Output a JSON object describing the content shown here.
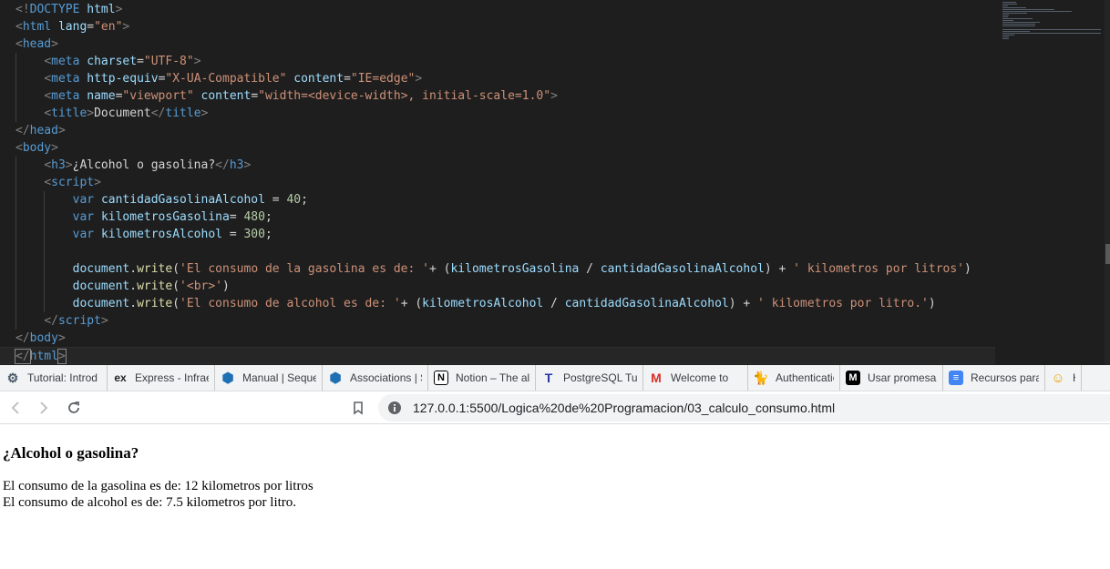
{
  "editor": {
    "lines": [
      [
        [
          "t-pun",
          "<!"
        ],
        [
          "t-doc",
          "DOCTYPE"
        ],
        [
          "t-text",
          " "
        ],
        [
          "t-attr",
          "html"
        ],
        [
          "t-pun",
          ">"
        ]
      ],
      [
        [
          "t-pun",
          "<"
        ],
        [
          "t-tag",
          "html"
        ],
        [
          "t-text",
          " "
        ],
        [
          "t-attr",
          "lang"
        ],
        [
          "t-text",
          "="
        ],
        [
          "t-str",
          "\"en\""
        ],
        [
          "t-pun",
          ">"
        ]
      ],
      [
        [
          "t-pun",
          "<"
        ],
        [
          "t-tag",
          "head"
        ],
        [
          "t-pun",
          ">"
        ]
      ],
      [
        [
          "t-text",
          "    "
        ],
        [
          "t-pun",
          "<"
        ],
        [
          "t-tag",
          "meta"
        ],
        [
          "t-text",
          " "
        ],
        [
          "t-attr",
          "charset"
        ],
        [
          "t-text",
          "="
        ],
        [
          "t-str",
          "\"UTF-8\""
        ],
        [
          "t-pun",
          ">"
        ]
      ],
      [
        [
          "t-text",
          "    "
        ],
        [
          "t-pun",
          "<"
        ],
        [
          "t-tag",
          "meta"
        ],
        [
          "t-text",
          " "
        ],
        [
          "t-attr",
          "http-equiv"
        ],
        [
          "t-text",
          "="
        ],
        [
          "t-str",
          "\"X-UA-Compatible\""
        ],
        [
          "t-text",
          " "
        ],
        [
          "t-attr",
          "content"
        ],
        [
          "t-text",
          "="
        ],
        [
          "t-str",
          "\"IE=edge\""
        ],
        [
          "t-pun",
          ">"
        ]
      ],
      [
        [
          "t-text",
          "    "
        ],
        [
          "t-pun",
          "<"
        ],
        [
          "t-tag",
          "meta"
        ],
        [
          "t-text",
          " "
        ],
        [
          "t-attr",
          "name"
        ],
        [
          "t-text",
          "="
        ],
        [
          "t-str",
          "\"viewport\""
        ],
        [
          "t-text",
          " "
        ],
        [
          "t-attr",
          "content"
        ],
        [
          "t-text",
          "="
        ],
        [
          "t-str",
          "\"width=<device-width>, initial-scale=1.0\""
        ],
        [
          "t-pun",
          ">"
        ]
      ],
      [
        [
          "t-text",
          "    "
        ],
        [
          "t-pun",
          "<"
        ],
        [
          "t-tag",
          "title"
        ],
        [
          "t-pun",
          ">"
        ],
        [
          "t-text",
          "Document"
        ],
        [
          "t-pun",
          "</"
        ],
        [
          "t-tag",
          "title"
        ],
        [
          "t-pun",
          ">"
        ]
      ],
      [
        [
          "t-pun",
          "</"
        ],
        [
          "t-tag",
          "head"
        ],
        [
          "t-pun",
          ">"
        ]
      ],
      [
        [
          "t-pun",
          "<"
        ],
        [
          "t-tag",
          "body"
        ],
        [
          "t-pun",
          ">"
        ]
      ],
      [
        [
          "t-text",
          "    "
        ],
        [
          "t-pun",
          "<"
        ],
        [
          "t-tag",
          "h3"
        ],
        [
          "t-pun",
          ">"
        ],
        [
          "t-text",
          "¿Alcohol o gasolina?"
        ],
        [
          "t-pun",
          "</"
        ],
        [
          "t-tag",
          "h3"
        ],
        [
          "t-pun",
          ">"
        ]
      ],
      [
        [
          "t-text",
          "    "
        ],
        [
          "t-pun",
          "<"
        ],
        [
          "t-tag",
          "script"
        ],
        [
          "t-pun",
          ">"
        ]
      ],
      [
        [
          "t-text",
          "        "
        ],
        [
          "t-kw",
          "var"
        ],
        [
          "t-text",
          " "
        ],
        [
          "t-var",
          "cantidadGasolinaAlcohol"
        ],
        [
          "t-text",
          " = "
        ],
        [
          "t-num",
          "40"
        ],
        [
          "t-text",
          ";"
        ]
      ],
      [
        [
          "t-text",
          "        "
        ],
        [
          "t-kw",
          "var"
        ],
        [
          "t-text",
          " "
        ],
        [
          "t-var",
          "kilometrosGasolina"
        ],
        [
          "t-text",
          "= "
        ],
        [
          "t-num",
          "480"
        ],
        [
          "t-text",
          ";"
        ]
      ],
      [
        [
          "t-text",
          "        "
        ],
        [
          "t-kw",
          "var"
        ],
        [
          "t-text",
          " "
        ],
        [
          "t-var",
          "kilometrosAlcohol"
        ],
        [
          "t-text",
          " = "
        ],
        [
          "t-num",
          "300"
        ],
        [
          "t-text",
          ";"
        ]
      ],
      [
        [
          "t-text",
          ""
        ]
      ],
      [
        [
          "t-text",
          "        "
        ],
        [
          "t-var",
          "document"
        ],
        [
          "t-text",
          "."
        ],
        [
          "t-fn",
          "write"
        ],
        [
          "t-text",
          "("
        ],
        [
          "t-str",
          "'El consumo de la gasolina es de: '"
        ],
        [
          "t-text",
          "+ ("
        ],
        [
          "t-var",
          "kilometrosGasolina"
        ],
        [
          "t-text",
          " / "
        ],
        [
          "t-var",
          "cantidadGasolinaAlcohol"
        ],
        [
          "t-text",
          ") + "
        ],
        [
          "t-str",
          "' kilometros por litros'"
        ],
        [
          "t-text",
          ")"
        ]
      ],
      [
        [
          "t-text",
          "        "
        ],
        [
          "t-var",
          "document"
        ],
        [
          "t-text",
          "."
        ],
        [
          "t-fn",
          "write"
        ],
        [
          "t-text",
          "("
        ],
        [
          "t-str",
          "'<br>'"
        ],
        [
          "t-text",
          ")"
        ]
      ],
      [
        [
          "t-text",
          "        "
        ],
        [
          "t-var",
          "document"
        ],
        [
          "t-text",
          "."
        ],
        [
          "t-fn",
          "write"
        ],
        [
          "t-text",
          "("
        ],
        [
          "t-str",
          "'El consumo de alcohol es de: '"
        ],
        [
          "t-text",
          "+ ("
        ],
        [
          "t-var",
          "kilometrosAlcohol"
        ],
        [
          "t-text",
          " / "
        ],
        [
          "t-var",
          "cantidadGasolinaAlcohol"
        ],
        [
          "t-text",
          ") + "
        ],
        [
          "t-str",
          "' kilometros por litro.'"
        ],
        [
          "t-text",
          ")"
        ]
      ],
      [
        [
          "t-text",
          "    "
        ],
        [
          "t-pun",
          "</"
        ],
        [
          "t-tag",
          "script"
        ],
        [
          "t-pun",
          ">"
        ]
      ],
      [
        [
          "t-pun",
          "</"
        ],
        [
          "t-tag",
          "body"
        ],
        [
          "t-pun",
          ">"
        ]
      ],
      [
        [
          "t-pun",
          "</"
        ],
        [
          "t-tag",
          "html"
        ],
        [
          "t-pun",
          ">"
        ]
      ]
    ]
  },
  "bookmarks": [
    {
      "label": "Tutorial: Introd",
      "icon": "gear-icon",
      "icon_text": "⚙",
      "color": "#4a5a6a"
    },
    {
      "label": "Express - Infrae",
      "icon": "express-icon",
      "icon_text": "ex",
      "color": "#ffffff"
    },
    {
      "label": "Manual | Seque",
      "icon": "sequelize-icon",
      "icon_text": "⬢",
      "color": "#1f6fb3"
    },
    {
      "label": "Associations | S",
      "icon": "sequelize-icon",
      "icon_text": "⬢",
      "color": "#1f6fb3"
    },
    {
      "label": "Notion – The al",
      "icon": "notion-icon",
      "icon_text": "N",
      "color": "#000000"
    },
    {
      "label": "PostgreSQL Tu",
      "icon": "postgresql-t-icon",
      "icon_text": "T",
      "color": "#2636a8"
    },
    {
      "label": "Welcome to",
      "icon": "gmail-icon",
      "icon_text": "M",
      "color": "#d93025"
    },
    {
      "label": "Authentication",
      "icon": "cat-icon",
      "icon_text": "🐈",
      "color": "#000000"
    },
    {
      "label": "Usar promesas",
      "icon": "mdn-icon",
      "icon_text": "M",
      "color": "#000000"
    },
    {
      "label": "Recursos para",
      "icon": "docs-icon",
      "icon_text": "≡",
      "color": "#4285f4"
    },
    {
      "label": "H",
      "icon": "avatar-icon",
      "icon_text": "☺",
      "color": "#e8a400"
    }
  ],
  "address_bar": {
    "url": "127.0.0.1:5500/Logica%20de%20Programacion/03_calculo_consumo.html"
  },
  "page": {
    "heading": "¿Alcohol o gasolina?",
    "line1": "El consumo de la gasolina es de: 12 kilometros por litros",
    "line2": "El consumo de alcohol es de: 7.5 kilometros por litro."
  }
}
